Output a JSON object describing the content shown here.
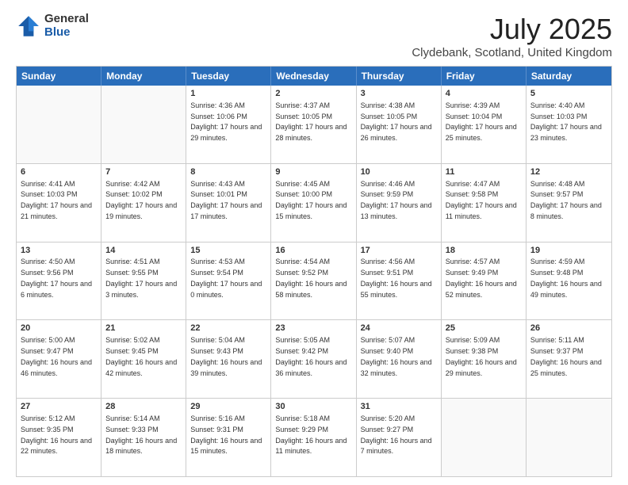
{
  "logo": {
    "general": "General",
    "blue": "Blue"
  },
  "title": "July 2025",
  "subtitle": "Clydebank, Scotland, United Kingdom",
  "headers": [
    "Sunday",
    "Monday",
    "Tuesday",
    "Wednesday",
    "Thursday",
    "Friday",
    "Saturday"
  ],
  "rows": [
    [
      {
        "day": "",
        "sunrise": "",
        "sunset": "",
        "daylight": "",
        "empty": true
      },
      {
        "day": "",
        "sunrise": "",
        "sunset": "",
        "daylight": "",
        "empty": true
      },
      {
        "day": "1",
        "sunrise": "Sunrise: 4:36 AM",
        "sunset": "Sunset: 10:06 PM",
        "daylight": "Daylight: 17 hours and 29 minutes."
      },
      {
        "day": "2",
        "sunrise": "Sunrise: 4:37 AM",
        "sunset": "Sunset: 10:05 PM",
        "daylight": "Daylight: 17 hours and 28 minutes."
      },
      {
        "day": "3",
        "sunrise": "Sunrise: 4:38 AM",
        "sunset": "Sunset: 10:05 PM",
        "daylight": "Daylight: 17 hours and 26 minutes."
      },
      {
        "day": "4",
        "sunrise": "Sunrise: 4:39 AM",
        "sunset": "Sunset: 10:04 PM",
        "daylight": "Daylight: 17 hours and 25 minutes."
      },
      {
        "day": "5",
        "sunrise": "Sunrise: 4:40 AM",
        "sunset": "Sunset: 10:03 PM",
        "daylight": "Daylight: 17 hours and 23 minutes."
      }
    ],
    [
      {
        "day": "6",
        "sunrise": "Sunrise: 4:41 AM",
        "sunset": "Sunset: 10:03 PM",
        "daylight": "Daylight: 17 hours and 21 minutes."
      },
      {
        "day": "7",
        "sunrise": "Sunrise: 4:42 AM",
        "sunset": "Sunset: 10:02 PM",
        "daylight": "Daylight: 17 hours and 19 minutes."
      },
      {
        "day": "8",
        "sunrise": "Sunrise: 4:43 AM",
        "sunset": "Sunset: 10:01 PM",
        "daylight": "Daylight: 17 hours and 17 minutes."
      },
      {
        "day": "9",
        "sunrise": "Sunrise: 4:45 AM",
        "sunset": "Sunset: 10:00 PM",
        "daylight": "Daylight: 17 hours and 15 minutes."
      },
      {
        "day": "10",
        "sunrise": "Sunrise: 4:46 AM",
        "sunset": "Sunset: 9:59 PM",
        "daylight": "Daylight: 17 hours and 13 minutes."
      },
      {
        "day": "11",
        "sunrise": "Sunrise: 4:47 AM",
        "sunset": "Sunset: 9:58 PM",
        "daylight": "Daylight: 17 hours and 11 minutes."
      },
      {
        "day": "12",
        "sunrise": "Sunrise: 4:48 AM",
        "sunset": "Sunset: 9:57 PM",
        "daylight": "Daylight: 17 hours and 8 minutes."
      }
    ],
    [
      {
        "day": "13",
        "sunrise": "Sunrise: 4:50 AM",
        "sunset": "Sunset: 9:56 PM",
        "daylight": "Daylight: 17 hours and 6 minutes."
      },
      {
        "day": "14",
        "sunrise": "Sunrise: 4:51 AM",
        "sunset": "Sunset: 9:55 PM",
        "daylight": "Daylight: 17 hours and 3 minutes."
      },
      {
        "day": "15",
        "sunrise": "Sunrise: 4:53 AM",
        "sunset": "Sunset: 9:54 PM",
        "daylight": "Daylight: 17 hours and 0 minutes."
      },
      {
        "day": "16",
        "sunrise": "Sunrise: 4:54 AM",
        "sunset": "Sunset: 9:52 PM",
        "daylight": "Daylight: 16 hours and 58 minutes."
      },
      {
        "day": "17",
        "sunrise": "Sunrise: 4:56 AM",
        "sunset": "Sunset: 9:51 PM",
        "daylight": "Daylight: 16 hours and 55 minutes."
      },
      {
        "day": "18",
        "sunrise": "Sunrise: 4:57 AM",
        "sunset": "Sunset: 9:49 PM",
        "daylight": "Daylight: 16 hours and 52 minutes."
      },
      {
        "day": "19",
        "sunrise": "Sunrise: 4:59 AM",
        "sunset": "Sunset: 9:48 PM",
        "daylight": "Daylight: 16 hours and 49 minutes."
      }
    ],
    [
      {
        "day": "20",
        "sunrise": "Sunrise: 5:00 AM",
        "sunset": "Sunset: 9:47 PM",
        "daylight": "Daylight: 16 hours and 46 minutes."
      },
      {
        "day": "21",
        "sunrise": "Sunrise: 5:02 AM",
        "sunset": "Sunset: 9:45 PM",
        "daylight": "Daylight: 16 hours and 42 minutes."
      },
      {
        "day": "22",
        "sunrise": "Sunrise: 5:04 AM",
        "sunset": "Sunset: 9:43 PM",
        "daylight": "Daylight: 16 hours and 39 minutes."
      },
      {
        "day": "23",
        "sunrise": "Sunrise: 5:05 AM",
        "sunset": "Sunset: 9:42 PM",
        "daylight": "Daylight: 16 hours and 36 minutes."
      },
      {
        "day": "24",
        "sunrise": "Sunrise: 5:07 AM",
        "sunset": "Sunset: 9:40 PM",
        "daylight": "Daylight: 16 hours and 32 minutes."
      },
      {
        "day": "25",
        "sunrise": "Sunrise: 5:09 AM",
        "sunset": "Sunset: 9:38 PM",
        "daylight": "Daylight: 16 hours and 29 minutes."
      },
      {
        "day": "26",
        "sunrise": "Sunrise: 5:11 AM",
        "sunset": "Sunset: 9:37 PM",
        "daylight": "Daylight: 16 hours and 25 minutes."
      }
    ],
    [
      {
        "day": "27",
        "sunrise": "Sunrise: 5:12 AM",
        "sunset": "Sunset: 9:35 PM",
        "daylight": "Daylight: 16 hours and 22 minutes."
      },
      {
        "day": "28",
        "sunrise": "Sunrise: 5:14 AM",
        "sunset": "Sunset: 9:33 PM",
        "daylight": "Daylight: 16 hours and 18 minutes."
      },
      {
        "day": "29",
        "sunrise": "Sunrise: 5:16 AM",
        "sunset": "Sunset: 9:31 PM",
        "daylight": "Daylight: 16 hours and 15 minutes."
      },
      {
        "day": "30",
        "sunrise": "Sunrise: 5:18 AM",
        "sunset": "Sunset: 9:29 PM",
        "daylight": "Daylight: 16 hours and 11 minutes."
      },
      {
        "day": "31",
        "sunrise": "Sunrise: 5:20 AM",
        "sunset": "Sunset: 9:27 PM",
        "daylight": "Daylight: 16 hours and 7 minutes."
      },
      {
        "day": "",
        "sunrise": "",
        "sunset": "",
        "daylight": "",
        "empty": true
      },
      {
        "day": "",
        "sunrise": "",
        "sunset": "",
        "daylight": "",
        "empty": true
      }
    ]
  ]
}
